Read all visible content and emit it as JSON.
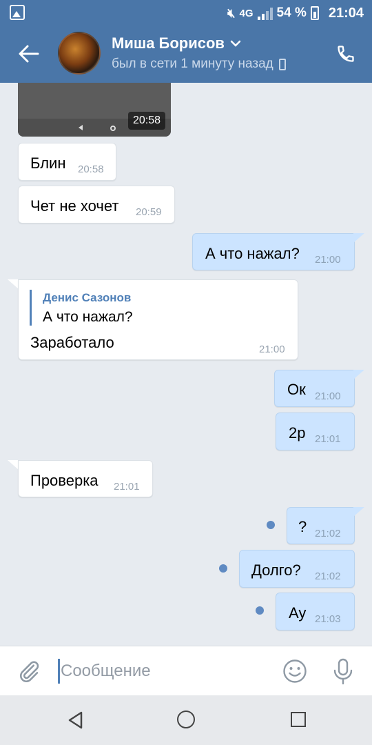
{
  "status_bar": {
    "network": "4G",
    "battery_percent": "54 %",
    "time": "21:04",
    "icons": [
      "image-icon",
      "mute-icon",
      "signal-icon",
      "battery-icon"
    ]
  },
  "header": {
    "contact_name": "Миша Борисов",
    "contact_status": "был в сети 1 минуту назад"
  },
  "messages": [
    {
      "direction": "in",
      "type": "video",
      "time": "20:58"
    },
    {
      "direction": "in",
      "text": "Блин",
      "time": "20:58"
    },
    {
      "direction": "in",
      "text": "Чет не хочет",
      "time": "20:59"
    },
    {
      "direction": "out",
      "text": "А что нажал?",
      "time": "21:00"
    },
    {
      "direction": "in",
      "reply_to": {
        "author": "Денис Сазонов",
        "text": "А что нажал?"
      },
      "text": "Заработало",
      "time": "21:00"
    },
    {
      "direction": "out",
      "text": "Ок",
      "time": "21:00"
    },
    {
      "direction": "out",
      "text": "2р",
      "time": "21:01"
    },
    {
      "direction": "in",
      "text": "Проверка",
      "time": "21:01"
    },
    {
      "direction": "out",
      "text": "?",
      "time": "21:02",
      "unread": true
    },
    {
      "direction": "out",
      "text": "Долго?",
      "time": "21:02",
      "unread": true
    },
    {
      "direction": "out",
      "text": "Ау",
      "time": "21:03",
      "unread": true
    }
  ],
  "composer": {
    "placeholder": "Сообщение"
  },
  "colors": {
    "header": "#4a76a8",
    "background": "#e7ebf0",
    "incoming": "#ffffff",
    "outgoing": "#cce4ff",
    "accent": "#5181b8"
  }
}
